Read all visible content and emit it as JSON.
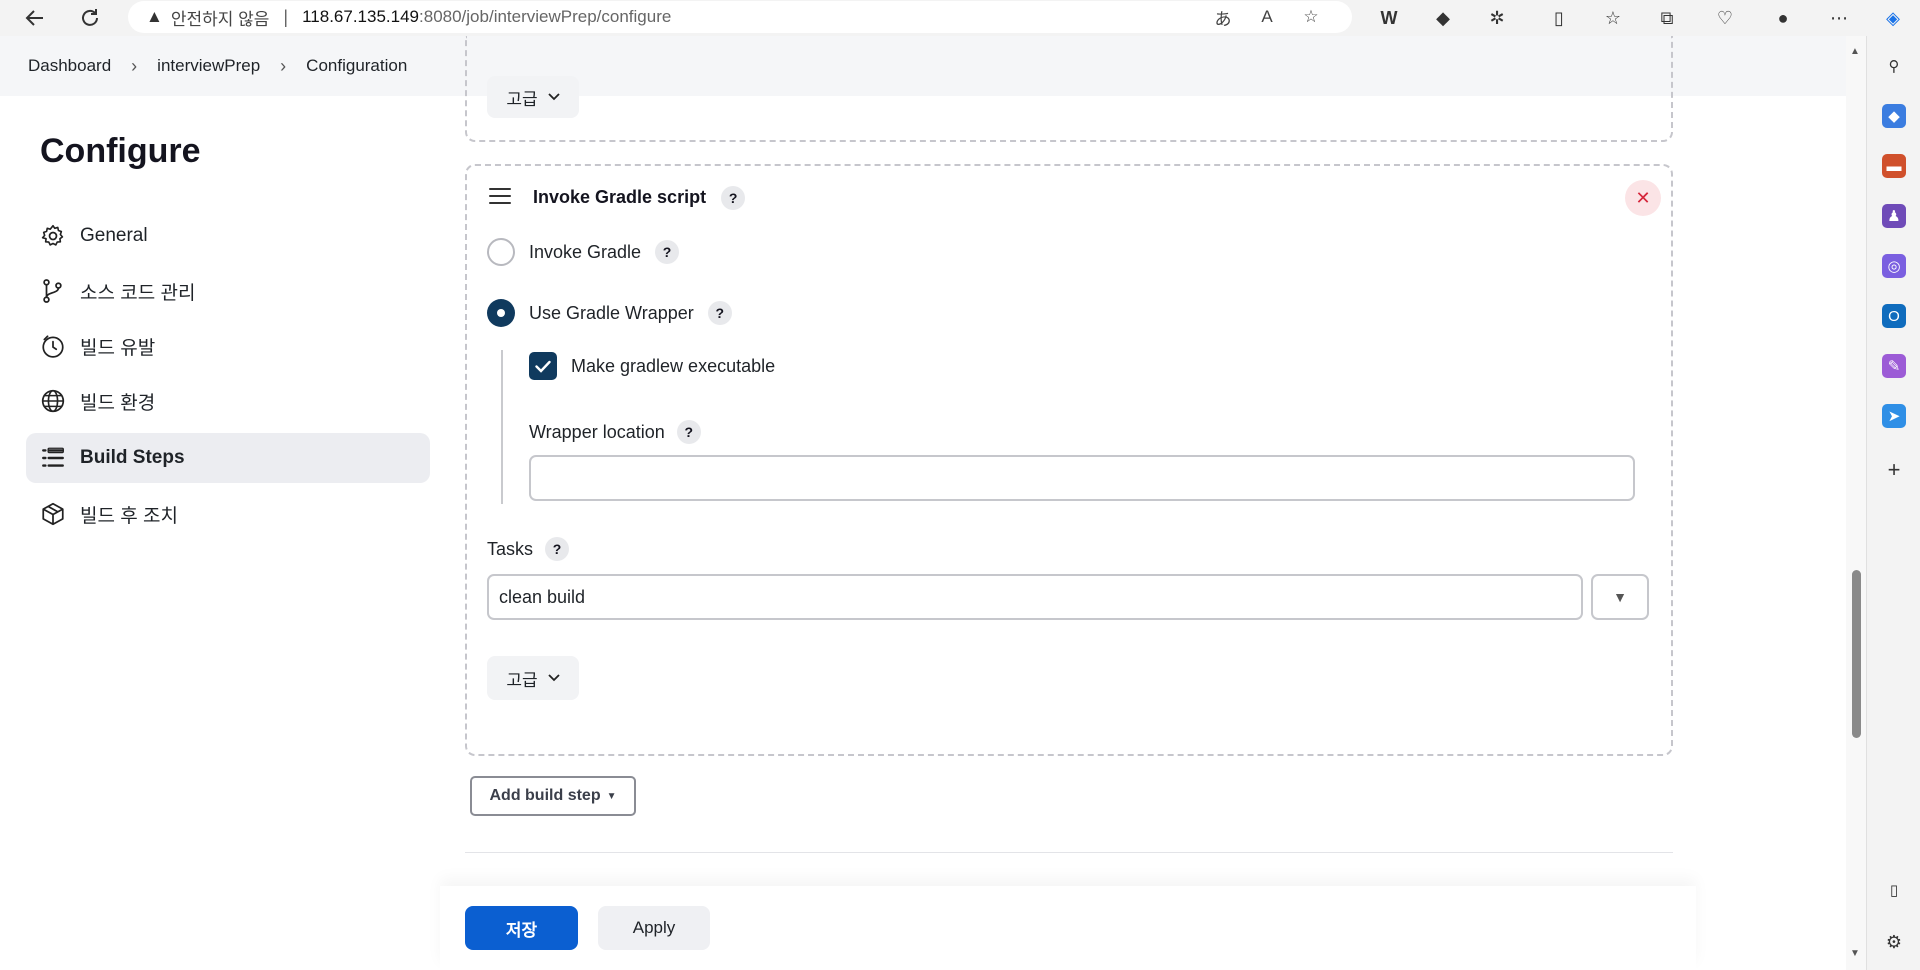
{
  "browser": {
    "insecure_label": "안전하지 않음",
    "url_host": "118.67.135.149",
    "url_rest": ":8080/job/interviewPrep/configure"
  },
  "breadcrumb": [
    "Dashboard",
    "interviewPrep",
    "Configuration"
  ],
  "sidebar": {
    "title": "Configure",
    "items": [
      {
        "label": "General",
        "icon": "gear-icon"
      },
      {
        "label": "소스 코드 관리",
        "icon": "branch-icon"
      },
      {
        "label": "빌드 유발",
        "icon": "timer-icon"
      },
      {
        "label": "빌드 환경",
        "icon": "globe-icon"
      },
      {
        "label": "Build Steps",
        "icon": "list-icon",
        "active": true
      },
      {
        "label": "빌드 후 조치",
        "icon": "package-icon"
      }
    ]
  },
  "main": {
    "top_advanced_label": "고급",
    "step": {
      "title": "Invoke Gradle script",
      "help": "?",
      "close": "✕",
      "radio_invoke_gradle": "Invoke Gradle",
      "radio_use_wrapper": "Use Gradle Wrapper",
      "selected_radio": "Use Gradle Wrapper",
      "checkbox_make_executable": "Make gradlew executable",
      "checkbox_checked": true,
      "wrapper_location_label": "Wrapper location",
      "wrapper_location_value": "",
      "tasks_label": "Tasks",
      "tasks_value": "clean build",
      "advanced_label": "고급"
    },
    "add_build_step_label": "Add build step",
    "save_label": "저장",
    "apply_label": "Apply"
  },
  "colors": {
    "primary": "#0b5fd1",
    "checked": "#103a5e",
    "danger": "#d5263b"
  }
}
